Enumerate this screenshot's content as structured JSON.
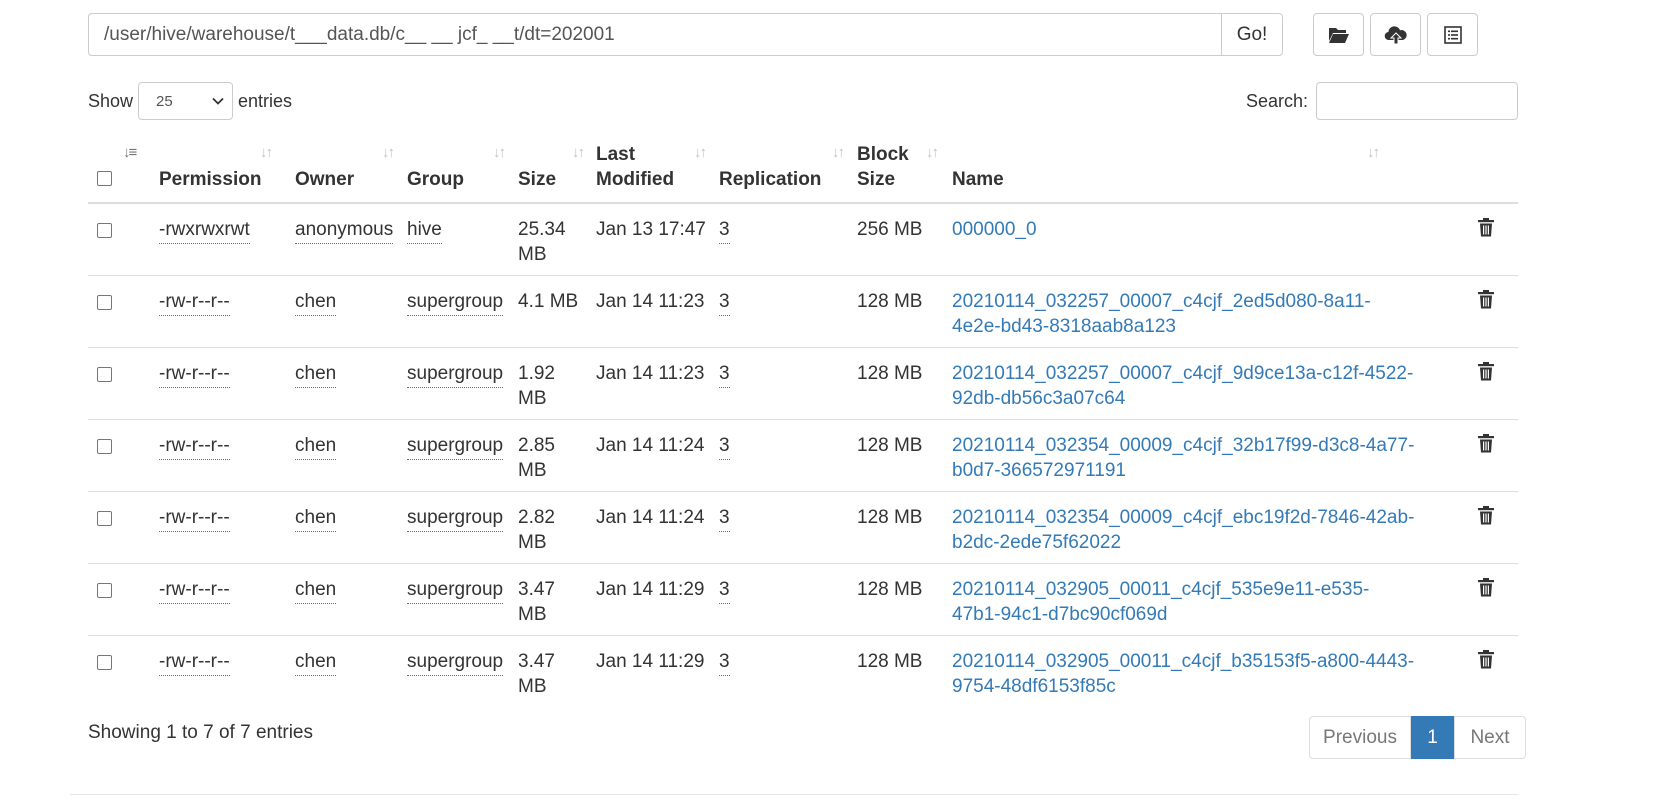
{
  "path_bar": {
    "path": "/user/hive/warehouse/t___data.db/c__ __ jcf_ __t/dt=202001",
    "go_label": "Go!"
  },
  "length": {
    "show_label": "Show",
    "value": "25",
    "entries_label": "entries"
  },
  "search": {
    "label": "Search:",
    "value": ""
  },
  "columns": {
    "permission": "Permission",
    "owner": "Owner",
    "group": "Group",
    "size": "Size",
    "last_modified_1": "Last",
    "last_modified_2": "Modified",
    "replication": "Replication",
    "block_size_1": "Block",
    "block_size_2": "Size",
    "name": "Name"
  },
  "rows": [
    {
      "permission": "-rwxrwxrwt",
      "owner": "anonymous",
      "group": "hive",
      "size": [
        "25.34",
        "MB"
      ],
      "modified": "Jan 13 17:47",
      "replication": "3",
      "block_size": "256 MB",
      "name": [
        "000000_0",
        ""
      ]
    },
    {
      "permission": "-rw-r--r--",
      "owner": "chen",
      "group": "supergroup",
      "size": [
        "4.1 MB",
        ""
      ],
      "modified": "Jan 14 11:23",
      "replication": "3",
      "block_size": "128 MB",
      "name": [
        "20210114_032257_00007_c4cjf_2ed5d080-8a11-",
        "4e2e-bd43-8318aab8a123"
      ]
    },
    {
      "permission": "-rw-r--r--",
      "owner": "chen",
      "group": "supergroup",
      "size": [
        "1.92",
        "MB"
      ],
      "modified": "Jan 14 11:23",
      "replication": "3",
      "block_size": "128 MB",
      "name": [
        "20210114_032257_00007_c4cjf_9d9ce13a-c12f-4522-",
        "92db-db56c3a07c64"
      ]
    },
    {
      "permission": "-rw-r--r--",
      "owner": "chen",
      "group": "supergroup",
      "size": [
        "2.85",
        "MB"
      ],
      "modified": "Jan 14 11:24",
      "replication": "3",
      "block_size": "128 MB",
      "name": [
        "20210114_032354_00009_c4cjf_32b17f99-d3c8-4a77-",
        "b0d7-366572971191"
      ]
    },
    {
      "permission": "-rw-r--r--",
      "owner": "chen",
      "group": "supergroup",
      "size": [
        "2.82",
        "MB"
      ],
      "modified": "Jan 14 11:24",
      "replication": "3",
      "block_size": "128 MB",
      "name": [
        "20210114_032354_00009_c4cjf_ebc19f2d-7846-42ab-",
        "b2dc-2ede75f62022"
      ]
    },
    {
      "permission": "-rw-r--r--",
      "owner": "chen",
      "group": "supergroup",
      "size": [
        "3.47",
        "MB"
      ],
      "modified": "Jan 14 11:29",
      "replication": "3",
      "block_size": "128 MB",
      "name": [
        "20210114_032905_00011_c4cjf_535e9e11-e535-",
        "47b1-94c1-d7bc90cf069d"
      ]
    },
    {
      "permission": "-rw-r--r--",
      "owner": "chen",
      "group": "supergroup",
      "size": [
        "3.47",
        "MB"
      ],
      "modified": "Jan 14 11:29",
      "replication": "3",
      "block_size": "128 MB",
      "name": [
        "20210114_032905_00011_c4cjf_b35153f5-a800-4443-",
        "9754-48df6153f85c"
      ]
    }
  ],
  "footer": {
    "info": "Showing 1 to 7 of 7 entries"
  },
  "pagination": {
    "previous": "Previous",
    "current": "1",
    "next": "Next"
  },
  "icons": {
    "folder": "folder-open-icon",
    "upload": "cloud-upload-icon",
    "list": "list-alt-icon",
    "trash": "trash-icon",
    "sort": "sort-icon",
    "chevron": "chevron-down-icon"
  },
  "colors": {
    "link": "#337ab7",
    "border": "#dddddd",
    "text": "#333333",
    "active_page": "#337ab7"
  }
}
